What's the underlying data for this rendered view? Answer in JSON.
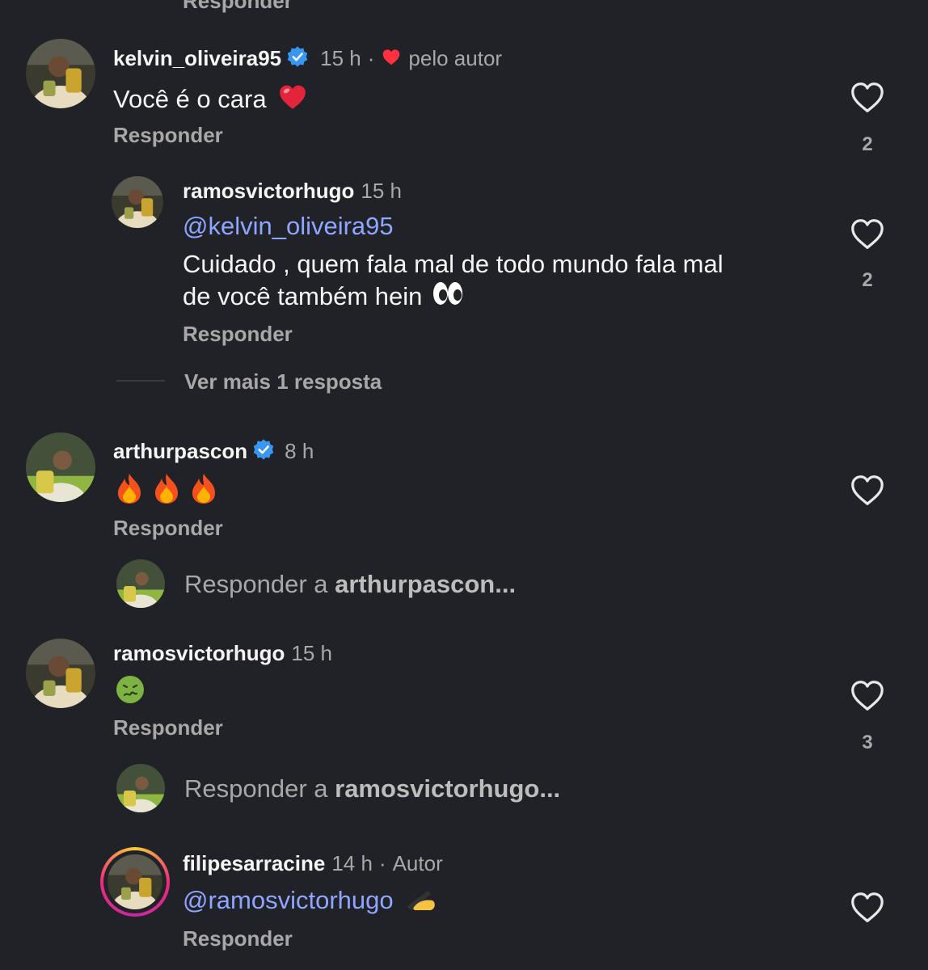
{
  "top_reply_label": "Responder",
  "comments": [
    {
      "username": "kelvin_oliveira95",
      "time": "15 h",
      "separator": "·",
      "liked_by_author": "pelo autor",
      "text": "Você é o cara",
      "reply_label": "Responder",
      "likes": "2"
    },
    {
      "username": "ramosvictorhugo",
      "time": "15 h",
      "mention": "@kelvin_oliveira95",
      "text_line1": "Cuidado , quem fala mal de todo mundo fala mal",
      "text_line2": "de você também hein",
      "reply_label": "Responder",
      "likes": "2"
    },
    {
      "view_more": "Ver mais 1 resposta"
    },
    {
      "username": "arthurpascon",
      "time": "8 h",
      "reply_label": "Responder",
      "reply_prompt_prefix": "Responder a ",
      "reply_prompt_user": "arthurpascon..."
    },
    {
      "username": "ramosvictorhugo",
      "time": "15 h",
      "reply_label": "Responder",
      "likes": "3",
      "reply_prompt_prefix": "Responder a ",
      "reply_prompt_user": "ramosvictorhugo..."
    },
    {
      "username": "filipesarracine",
      "time": "14 h",
      "separator": "·",
      "author_badge": "Autor",
      "mention": "@ramosvictorhugo",
      "reply_label": "Responder"
    }
  ],
  "icons": {
    "verified": "verified-badge-icon",
    "heart_outline": "heart-outline-icon",
    "heart_filled": "red-heart-icon",
    "emoji_heart": "red-heart-emoji",
    "emoji_eyes": "eyes-emoji",
    "emoji_fire": "fire-emoji",
    "emoji_nauseated": "nauseated-face-emoji",
    "emoji_writing": "writing-hand-emoji"
  },
  "colors": {
    "background": "#212227",
    "mention": "#8ea6ff",
    "verified": "#3897f0",
    "like_red": "#ff3040"
  }
}
